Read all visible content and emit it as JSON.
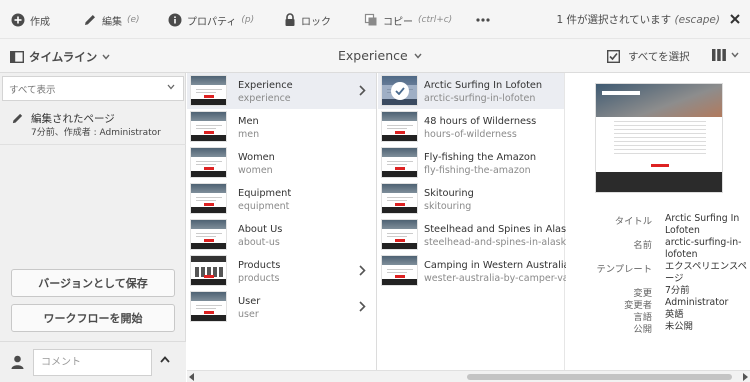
{
  "toolbar": {
    "create": "作成",
    "edit": "編集",
    "edit_shortcut": "(e)",
    "properties": "プロパティ",
    "properties_shortcut": "(p)",
    "lock": "ロック",
    "copy": "コピー",
    "copy_shortcut": "(ctrl+c)",
    "selection_status": "1 件が選択されています",
    "selection_shortcut": "(escape)"
  },
  "subbar": {
    "rail_label": "タイムライン",
    "collection_title": "Experience",
    "select_all": "すべてを選択"
  },
  "rail": {
    "filter_value": "すべて表示",
    "timeline_entry": {
      "title": "編集されたページ",
      "subtitle": "7分前、作成者 : Administrator"
    },
    "save_version": "バージョンとして保存",
    "start_workflow": "ワークフローを開始",
    "comment_placeholder": "コメント"
  },
  "column1": [
    {
      "title": "Experience",
      "name": "experience",
      "has_children": true,
      "selected": true
    },
    {
      "title": "Men",
      "name": "men",
      "has_children": false,
      "selected": false
    },
    {
      "title": "Women",
      "name": "women",
      "has_children": false,
      "selected": false
    },
    {
      "title": "Equipment",
      "name": "equipment",
      "has_children": false,
      "selected": false
    },
    {
      "title": "About Us",
      "name": "about-us",
      "has_children": false,
      "selected": false
    },
    {
      "title": "Products",
      "name": "products",
      "has_children": true,
      "selected": false
    },
    {
      "title": "User",
      "name": "user",
      "has_children": true,
      "selected": false
    }
  ],
  "column2": [
    {
      "title": "Arctic Surfing In Lofoten",
      "name": "arctic-surfing-in-lofoten",
      "selected": true
    },
    {
      "title": "48 hours of Wilderness",
      "name": "hours-of-wilderness",
      "selected": false
    },
    {
      "title": "Fly-fishing the Amazon",
      "name": "fly-fishing-the-amazon",
      "selected": false
    },
    {
      "title": "Skitouring",
      "name": "skitouring",
      "selected": false
    },
    {
      "title": "Steelhead and Spines in Alaska",
      "name": "steelhead-and-spines-in-alaska",
      "selected": false
    },
    {
      "title": "Camping in Western Australia",
      "name": "wester-australia-by-camper-van",
      "selected": false
    }
  ],
  "details": {
    "fields": [
      {
        "label": "タイトル",
        "value": "Arctic Surfing In Lofoten"
      },
      {
        "label": "名前",
        "value": "arctic-surfing-in-lofoten"
      },
      {
        "label": "テンプレート",
        "value": "エクスペリエンスページ"
      },
      {
        "label": "変更",
        "value": "7分前"
      },
      {
        "label": "変更者",
        "value": "Administrator"
      },
      {
        "label": "言語",
        "value": "英語"
      },
      {
        "label": "公開",
        "value": "未公開"
      }
    ]
  },
  "colors": {
    "selected_bg": "#ebedf2",
    "toolbar_bg": "#f5f5f5",
    "rail_bg": "#f0f0f0"
  }
}
